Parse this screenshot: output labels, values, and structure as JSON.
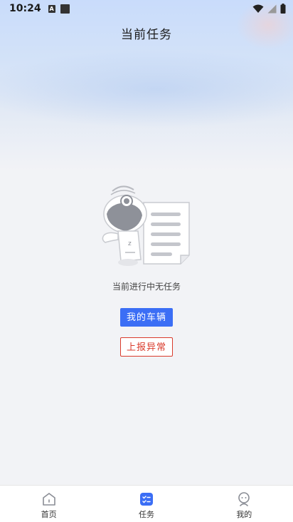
{
  "status_bar": {
    "time": "10:24",
    "icons": [
      "a-notification-icon",
      "square-notification-icon",
      "wifi-icon",
      "signal-icon",
      "battery-icon"
    ]
  },
  "header": {
    "title": "当前任务"
  },
  "empty_state": {
    "illustration": "robot-with-document",
    "message": "当前进行中无任务"
  },
  "actions": {
    "my_vehicles_label": "我的车辆",
    "report_exception_label": "上报异常"
  },
  "bottom_nav": {
    "items": [
      {
        "label": "首页",
        "icon": "home-icon",
        "active": false
      },
      {
        "label": "任务",
        "icon": "task-icon",
        "active": true
      },
      {
        "label": "我的",
        "icon": "profile-icon",
        "active": false
      }
    ]
  },
  "colors": {
    "primary": "#3b6ef5",
    "danger": "#d93a2b",
    "background": "#f2f3f6"
  }
}
